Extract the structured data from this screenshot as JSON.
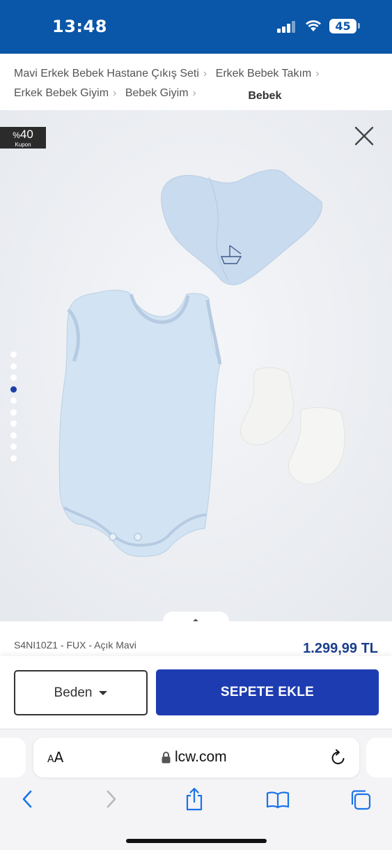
{
  "status_bar": {
    "time": "13:48",
    "battery": "45",
    "icons": [
      "signal-icon",
      "wifi-icon",
      "battery-icon"
    ]
  },
  "breadcrumb": {
    "items": [
      "Mavi Erkek Bebek Hastane Çıkış Seti",
      "Erkek Bebek Takım",
      "Erkek Bebek Giyim",
      "Bebek Giyim"
    ],
    "current": "Bebek"
  },
  "product_image": {
    "coupon_percent": "%",
    "coupon_value": "40",
    "coupon_label": "Kupon",
    "slide_count": 10,
    "active_slide": 3,
    "background_color": "#eef0f4"
  },
  "product": {
    "sku": "S4NI10Z1 - FUX - Açık Mavi",
    "price": "1.299,99 TL"
  },
  "actions": {
    "size_label": "Beden",
    "add_to_cart_label": "SEPETE EKLE",
    "accent_color": "#1e3cb1"
  },
  "browser": {
    "text_size_small": "A",
    "text_size_large": "A",
    "url": "lcw.com",
    "toolbar_icons": [
      "back-icon",
      "forward-icon",
      "share-icon",
      "bookmarks-icon",
      "tabs-icon"
    ]
  },
  "colors": {
    "header": "#0a56a8",
    "price": "#1a3e8c"
  }
}
